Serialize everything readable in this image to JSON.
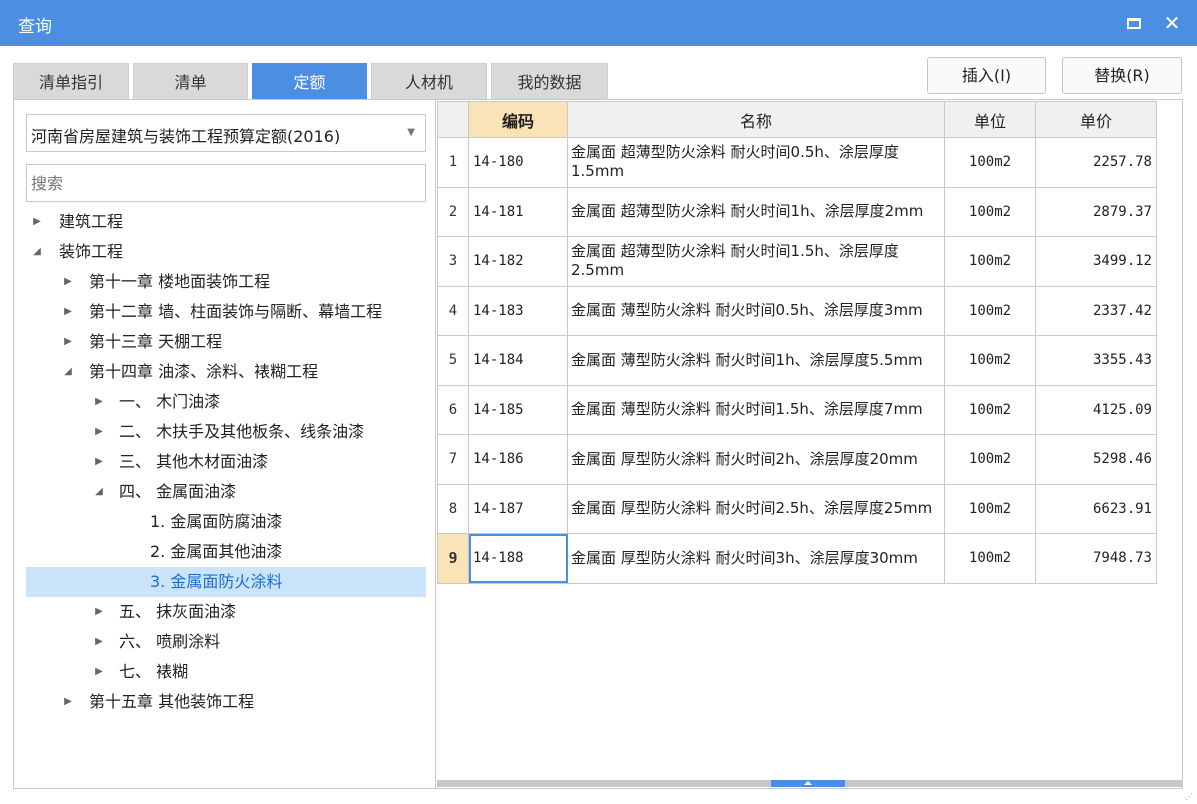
{
  "window": {
    "title": "查询"
  },
  "tabs": [
    {
      "label": "清单指引",
      "active": false
    },
    {
      "label": "清单",
      "active": false
    },
    {
      "label": "定额",
      "active": true
    },
    {
      "label": "人材机",
      "active": false
    },
    {
      "label": "我的数据",
      "active": false
    }
  ],
  "buttons": {
    "insert": "插入(I)",
    "replace": "替换(R)"
  },
  "library": {
    "selected": "河南省房屋建筑与装饰工程预算定额(2016)"
  },
  "search": {
    "placeholder": "搜索"
  },
  "tree": [
    {
      "label": "建筑工程",
      "state": "collapsed"
    },
    {
      "label": "装饰工程",
      "state": "expanded"
    },
    {
      "label": "第十一章 楼地面装饰工程",
      "state": "collapsed"
    },
    {
      "label": "第十二章 墙、柱面装饰与隔断、幕墙工程",
      "state": "collapsed"
    },
    {
      "label": "第十三章 天棚工程",
      "state": "collapsed"
    },
    {
      "label": "第十四章 油漆、涂料、裱糊工程",
      "state": "expanded"
    },
    {
      "label": "一、 木门油漆",
      "state": "collapsed"
    },
    {
      "label": "二、 木扶手及其他板条、线条油漆",
      "state": "collapsed"
    },
    {
      "label": "三、 其他木材面油漆",
      "state": "collapsed"
    },
    {
      "label": "四、 金属面油漆",
      "state": "expanded"
    },
    {
      "label": "1. 金属面防腐油漆",
      "state": "leaf"
    },
    {
      "label": "2. 金属面其他油漆",
      "state": "leaf"
    },
    {
      "label": "3. 金属面防火涂料",
      "state": "leaf",
      "selected": true
    },
    {
      "label": "五、 抹灰面油漆",
      "state": "collapsed"
    },
    {
      "label": "六、 喷刷涂料",
      "state": "collapsed"
    },
    {
      "label": "七、 裱糊",
      "state": "collapsed"
    },
    {
      "label": "第十五章 其他装饰工程",
      "state": "collapsed"
    }
  ],
  "table": {
    "headers": {
      "code": "编码",
      "name": "名称",
      "unit": "单位",
      "price": "单价"
    },
    "rows": [
      {
        "n": "1",
        "code": "14-180",
        "name": "金属面 超薄型防火涂料 耐火时间0.5h、涂层厚度1.5mm",
        "unit": "100m2",
        "price": "2257.78"
      },
      {
        "n": "2",
        "code": "14-181",
        "name": "金属面 超薄型防火涂料 耐火时间1h、涂层厚度2mm",
        "unit": "100m2",
        "price": "2879.37"
      },
      {
        "n": "3",
        "code": "14-182",
        "name": "金属面 超薄型防火涂料 耐火时间1.5h、涂层厚度2.5mm",
        "unit": "100m2",
        "price": "3499.12"
      },
      {
        "n": "4",
        "code": "14-183",
        "name": "金属面 薄型防火涂料 耐火时间0.5h、涂层厚度3mm",
        "unit": "100m2",
        "price": "2337.42"
      },
      {
        "n": "5",
        "code": "14-184",
        "name": "金属面 薄型防火涂料 耐火时间1h、涂层厚度5.5mm",
        "unit": "100m2",
        "price": "3355.43"
      },
      {
        "n": "6",
        "code": "14-185",
        "name": "金属面 薄型防火涂料 耐火时间1.5h、涂层厚度7mm",
        "unit": "100m2",
        "price": "4125.09"
      },
      {
        "n": "7",
        "code": "14-186",
        "name": "金属面 厚型防火涂料 耐火时间2h、涂层厚度20mm",
        "unit": "100m2",
        "price": "5298.46"
      },
      {
        "n": "8",
        "code": "14-187",
        "name": "金属面 厚型防火涂料 耐火时间2.5h、涂层厚度25mm",
        "unit": "100m2",
        "price": "6623.91"
      },
      {
        "n": "9",
        "code": "14-188",
        "name": "金属面 厚型防火涂料 耐火时间3h、涂层厚度30mm",
        "unit": "100m2",
        "price": "7948.73",
        "current": true
      }
    ]
  }
}
